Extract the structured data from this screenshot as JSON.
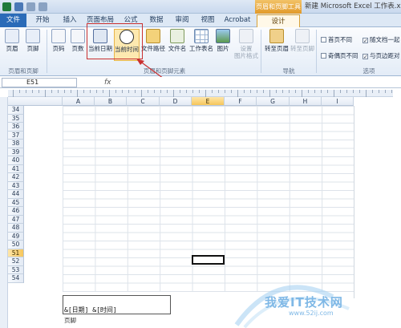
{
  "titlebar": {
    "context_tool": "页眉和页脚工具",
    "window_title": "新建 Microsoft Excel 工作表.xlsx"
  },
  "tabs": [
    "文件",
    "开始",
    "插入",
    "页面布局",
    "公式",
    "数据",
    "审阅",
    "视图",
    "Acrobat",
    "设计"
  ],
  "ribbon": {
    "group1": {
      "label": "页眉和页脚",
      "buttons": [
        "页眉",
        "页脚"
      ]
    },
    "group2": {
      "label": "页眉和页脚元素",
      "buttons": [
        "页码",
        "页数",
        "当前日期",
        "当前时间",
        "文件路径",
        "文件名",
        "工作表名",
        "图片",
        "设置\n图片格式"
      ]
    },
    "group3": {
      "label": "导航",
      "buttons": [
        "转至页眉",
        "转至页脚"
      ]
    },
    "group4": {
      "label": "选项",
      "checkboxes": [
        {
          "label": "首页不同",
          "checked": false
        },
        {
          "label": "随文档一起",
          "checked": true
        },
        {
          "label": "奇偶页不同",
          "checked": false
        },
        {
          "label": "与页边距对",
          "checked": true
        }
      ]
    }
  },
  "formula_bar": {
    "name_box": "E51",
    "fx": "fx"
  },
  "columns": [
    "A",
    "B",
    "C",
    "D",
    "E",
    "F",
    "G",
    "H",
    "I"
  ],
  "selected_column": "E",
  "rows": [
    "34",
    "35",
    "36",
    "37",
    "38",
    "39",
    "40",
    "41",
    "42",
    "43",
    "44",
    "45",
    "46",
    "47",
    "48",
    "49",
    "50",
    "51",
    "52",
    "53",
    "54"
  ],
  "selected_row": "51",
  "footer": {
    "content": "&[日期] &[时间]",
    "label": "页脚"
  },
  "watermark": {
    "text": "我爱IT技术网",
    "url": "www.52ij.com"
  },
  "colors": {
    "file_tab": "#2a6bb8",
    "context_accent": "#e29a2a",
    "highlight": "#c93030",
    "selected_header": "#f6c65b"
  }
}
